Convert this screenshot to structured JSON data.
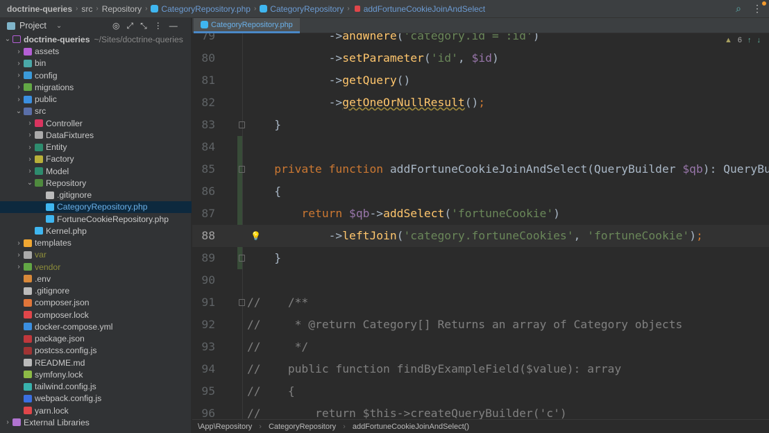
{
  "navbar": {
    "project": "doctrine-queries",
    "crumbs": [
      "src",
      "Repository"
    ],
    "file": "CategoryRepository.php",
    "class": "CategoryRepository",
    "method": "addFortuneCookieJoinAndSelect"
  },
  "sidebar": {
    "title": "Project",
    "root": {
      "name": "doctrine-queries",
      "path": "~/Sites/doctrine-queries"
    },
    "items": [
      {
        "label": "assets",
        "depth": 1,
        "arrow": ">",
        "color": "#b45fd6"
      },
      {
        "label": "bin",
        "depth": 1,
        "arrow": ">",
        "color": "#4aa8a8"
      },
      {
        "label": "config",
        "depth": 1,
        "arrow": ">",
        "color": "#3b9ad9"
      },
      {
        "label": "migrations",
        "depth": 1,
        "arrow": ">",
        "color": "#62a745"
      },
      {
        "label": "public",
        "depth": 1,
        "arrow": ">",
        "color": "#3b8fe0"
      },
      {
        "label": "src",
        "depth": 1,
        "arrow": "v",
        "color": "#5a6fa8"
      },
      {
        "label": "Controller",
        "depth": 2,
        "arrow": ">",
        "color": "#d9345f"
      },
      {
        "label": "DataFixtures",
        "depth": 2,
        "arrow": ">",
        "color": "#aaaaaa"
      },
      {
        "label": "Entity",
        "depth": 2,
        "arrow": ">",
        "color": "#2e8c6e"
      },
      {
        "label": "Factory",
        "depth": 2,
        "arrow": ">",
        "color": "#b8b03a"
      },
      {
        "label": "Model",
        "depth": 2,
        "arrow": ">",
        "color": "#2e8c6e"
      },
      {
        "label": "Repository",
        "depth": 2,
        "arrow": "v",
        "color": "#4f8a3e"
      },
      {
        "label": ".gitignore",
        "depth": 3,
        "arrow": "",
        "color": "#bbbbbb"
      },
      {
        "label": "CategoryRepository.php",
        "depth": 3,
        "arrow": "",
        "color": "#3fb6f0",
        "selected": true
      },
      {
        "label": "FortuneCookieRepository.php",
        "depth": 3,
        "arrow": "",
        "color": "#3fb6f0"
      },
      {
        "label": "Kernel.php",
        "depth": 2,
        "arrow": "",
        "color": "#3fb6f0"
      },
      {
        "label": "templates",
        "depth": 1,
        "arrow": ">",
        "color": "#f0a732"
      },
      {
        "label": "var",
        "depth": 1,
        "arrow": ">",
        "color": "#aaaaaa",
        "text_color": "#8c8c3a"
      },
      {
        "label": "vendor",
        "depth": 1,
        "arrow": ">",
        "color": "#62a745",
        "text_color": "#8c8c3a"
      },
      {
        "label": ".env",
        "depth": 1,
        "arrow": "",
        "color": "#d9893a"
      },
      {
        "label": ".gitignore",
        "depth": 1,
        "arrow": "",
        "color": "#bbbbbb"
      },
      {
        "label": "composer.json",
        "depth": 1,
        "arrow": "",
        "color": "#e0763a"
      },
      {
        "label": "composer.lock",
        "depth": 1,
        "arrow": "",
        "color": "#e0464a"
      },
      {
        "label": "docker-compose.yml",
        "depth": 1,
        "arrow": "",
        "color": "#3b8fe0"
      },
      {
        "label": "package.json",
        "depth": 1,
        "arrow": "",
        "color": "#c0383c"
      },
      {
        "label": "postcss.config.js",
        "depth": 1,
        "arrow": "",
        "color": "#a03434"
      },
      {
        "label": "README.md",
        "depth": 1,
        "arrow": "",
        "color": "#bbbbbb"
      },
      {
        "label": "symfony.lock",
        "depth": 1,
        "arrow": "",
        "color": "#8dbb46"
      },
      {
        "label": "tailwind.config.js",
        "depth": 1,
        "arrow": "",
        "color": "#38b2ac"
      },
      {
        "label": "webpack.config.js",
        "depth": 1,
        "arrow": "",
        "color": "#3b6fe0"
      },
      {
        "label": "yarn.lock",
        "depth": 1,
        "arrow": "",
        "color": "#e0464a"
      },
      {
        "label": "External Libraries",
        "depth": 0,
        "arrow": ">",
        "color": "#b074d0"
      }
    ]
  },
  "tab": {
    "label": "CategoryRepository.php"
  },
  "inspections": {
    "warnings": "6"
  },
  "editor": {
    "current_line": 88,
    "lines": [
      {
        "n": "79",
        "t": [
          [
            "p",
            "            "
          ],
          [
            "p",
            "->"
          ],
          [
            "m",
            "andWhere"
          ],
          [
            "p",
            "("
          ],
          [
            "s",
            "'category.id = :id'"
          ],
          [
            "p",
            ")"
          ]
        ]
      },
      {
        "n": "80",
        "t": [
          [
            "p",
            "            ->"
          ],
          [
            "m",
            "setParameter"
          ],
          [
            "p",
            "("
          ],
          [
            "s",
            "'id'"
          ],
          [
            "p",
            ", "
          ],
          [
            "v",
            "$id"
          ],
          [
            "p",
            ")"
          ]
        ]
      },
      {
        "n": "81",
        "t": [
          [
            "p",
            "            ->"
          ],
          [
            "m",
            "getQuery"
          ],
          [
            "p",
            "()"
          ]
        ]
      },
      {
        "n": "82",
        "t": [
          [
            "p",
            "            ->"
          ],
          [
            "mu",
            "getOneOrNullResult"
          ],
          [
            "p",
            "()"
          ],
          [
            "kw",
            ";"
          ]
        ]
      },
      {
        "n": "83",
        "t": [
          [
            "p",
            "    }"
          ]
        ]
      },
      {
        "n": "84",
        "t": []
      },
      {
        "n": "85",
        "t": [
          [
            "kw",
            "    private function "
          ],
          [
            "fn",
            "addFortuneCookieJoinAndSelect"
          ],
          [
            "p",
            "(QueryBuilder "
          ],
          [
            "v",
            "$qb"
          ],
          [
            "p",
            "): QueryBuilder"
          ]
        ]
      },
      {
        "n": "86",
        "t": [
          [
            "p",
            "    {"
          ]
        ]
      },
      {
        "n": "87",
        "t": [
          [
            "kw",
            "        return "
          ],
          [
            "v",
            "$qb"
          ],
          [
            "p",
            "->"
          ],
          [
            "m",
            "addSelect"
          ],
          [
            "p",
            "("
          ],
          [
            "s",
            "'fortuneCookie'"
          ],
          [
            "p",
            ")"
          ]
        ]
      },
      {
        "n": "88",
        "t": [
          [
            "p",
            "            ->"
          ],
          [
            "m",
            "leftJoin"
          ],
          [
            "p",
            "("
          ],
          [
            "s",
            "'category.fortuneCookies'"
          ],
          [
            "p",
            ", "
          ],
          [
            "s",
            "'fortuneCookie'"
          ],
          [
            "p",
            ")"
          ],
          [
            "kw",
            ";"
          ]
        ]
      },
      {
        "n": "89",
        "t": [
          [
            "p",
            "    }"
          ]
        ]
      },
      {
        "n": "90",
        "t": []
      },
      {
        "n": "91",
        "t": [
          [
            "c",
            "//    /**"
          ]
        ]
      },
      {
        "n": "92",
        "t": [
          [
            "c",
            "//     * @return Category[] Returns an array of Category objects"
          ]
        ]
      },
      {
        "n": "93",
        "t": [
          [
            "c",
            "//     */"
          ]
        ]
      },
      {
        "n": "94",
        "t": [
          [
            "c",
            "//    public function findByExampleField($value): array"
          ]
        ]
      },
      {
        "n": "95",
        "t": [
          [
            "c",
            "//    {"
          ]
        ]
      },
      {
        "n": "96",
        "t": [
          [
            "c",
            "//        return $this->createQueryBuilder('c')"
          ]
        ]
      }
    ]
  },
  "statusbar": {
    "crumbs": [
      "\\App\\Repository",
      "CategoryRepository",
      "addFortuneCookieJoinAndSelect()"
    ]
  }
}
